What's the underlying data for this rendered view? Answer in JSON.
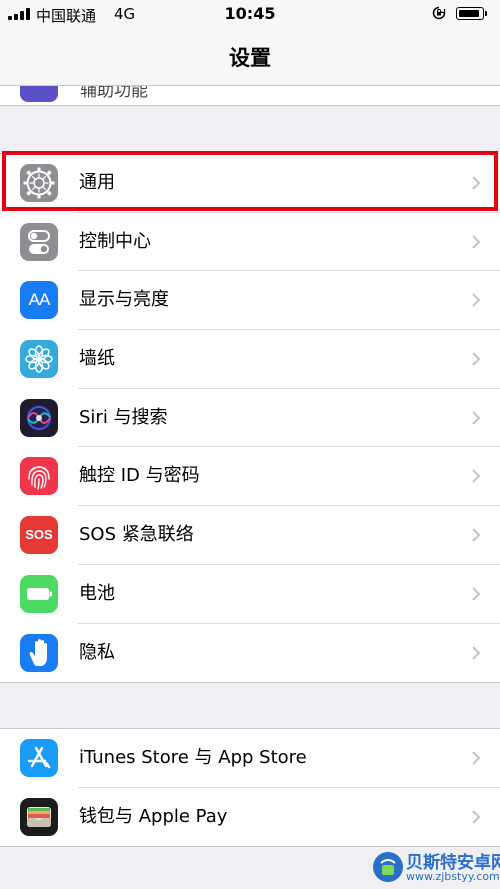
{
  "status_bar": {
    "carrier": "中国联通",
    "network": "4G",
    "time": "10:45"
  },
  "nav": {
    "title": "设置"
  },
  "partial_row": {
    "label": "辅助功能"
  },
  "groups": [
    {
      "items": [
        {
          "label": "通用",
          "icon": "gear-icon",
          "color": "#8e8e93",
          "highlighted": true
        },
        {
          "label": "控制中心",
          "icon": "toggles-icon",
          "color": "#8e8e93"
        },
        {
          "label": "显示与亮度",
          "icon": "text-size-icon",
          "color": "#1a7cf5"
        },
        {
          "label": "墙纸",
          "icon": "flower-icon",
          "color": "#35aadc"
        },
        {
          "label": "Siri 与搜索",
          "icon": "siri-icon",
          "color": "#1c1c2e"
        },
        {
          "label": "触控 ID 与密码",
          "icon": "fingerprint-icon",
          "color": "#f0364b"
        },
        {
          "label": "SOS 紧急联络",
          "icon": "sos-icon",
          "color": "#e53935"
        },
        {
          "label": "电池",
          "icon": "battery-icon",
          "color": "#4cd964"
        },
        {
          "label": "隐私",
          "icon": "hand-icon",
          "color": "#1a7cf5"
        }
      ]
    },
    {
      "items": [
        {
          "label": "iTunes Store 与 App Store",
          "icon": "app-store-icon",
          "color": "#1a9bf5"
        },
        {
          "label": "钱包与 Apple Pay",
          "icon": "wallet-icon",
          "color": "#1c1c1c"
        }
      ]
    }
  ],
  "sos_text": "SOS",
  "display_icon_text": "AA",
  "watermark": {
    "name": "贝斯特安卓网",
    "url": "www.zjbstyy.com"
  }
}
